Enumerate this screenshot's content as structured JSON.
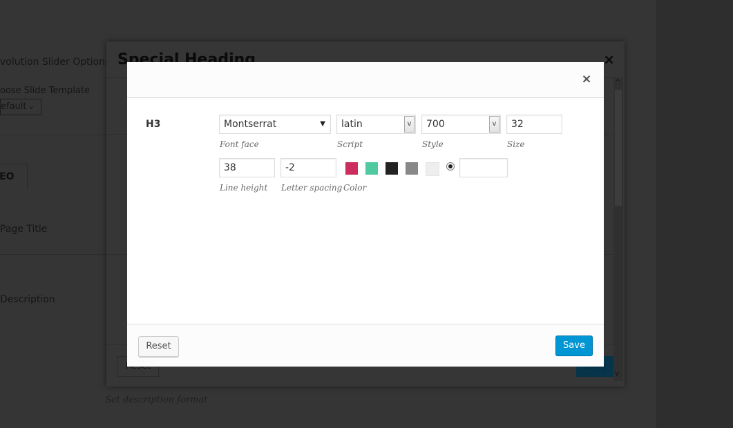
{
  "background": {
    "texts": {
      "slider_options": "volution Slider Options",
      "slide_template": "oose Slide Template",
      "template_value": "efault",
      "seo_tab": "EO",
      "page_title": "Page Title",
      "description": "Description",
      "set_description": "Set description format"
    },
    "outer_modal": {
      "title": "Special Heading",
      "close_icon": "×",
      "reset_label": "Reset",
      "save_label": "Save"
    }
  },
  "modal": {
    "close_icon": "×",
    "heading_level": "H3",
    "font_face": {
      "value": "Montserrat",
      "label": "Font face"
    },
    "script": {
      "value": "latin",
      "label": "Script"
    },
    "style": {
      "value": "700",
      "label": "Style"
    },
    "size": {
      "value": "32",
      "label": "Size"
    },
    "line_height": {
      "value": "38",
      "label": "Line height"
    },
    "letter_spacing": {
      "value": "-2",
      "label": "Letter spacing"
    },
    "color": {
      "label": "Color",
      "swatches": [
        "#cc2c5e",
        "#4ec9a0",
        "#222222",
        "#888888",
        "#eeeeee"
      ],
      "custom_value": ""
    },
    "footer": {
      "reset_label": "Reset",
      "save_label": "Save"
    }
  }
}
